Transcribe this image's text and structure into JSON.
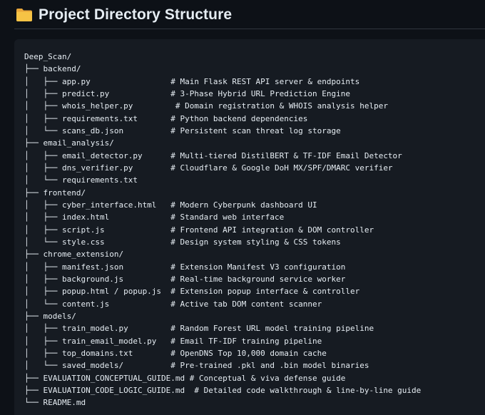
{
  "header": {
    "title": "Project Directory Structure",
    "icon": "folder-icon",
    "icon_color": "#f0b43a"
  },
  "tree_lines": [
    "Deep_Scan/",
    "├── backend/",
    "│   ├── app.py                 # Main Flask REST API server & endpoints",
    "│   ├── predict.py             # 3-Phase Hybrid URL Prediction Engine",
    "│   ├── whois_helper.py         # Domain registration & WHOIS analysis helper",
    "│   ├── requirements.txt       # Python backend dependencies",
    "│   └── scans_db.json          # Persistent scan threat log storage",
    "├── email_analysis/",
    "│   ├── email_detector.py      # Multi-tiered DistilBERT & TF-IDF Email Detector",
    "│   ├── dns_verifier.py        # Cloudflare & Google DoH MX/SPF/DMARC verifier",
    "│   └── requirements.txt",
    "├── frontend/",
    "│   ├── cyber_interface.html   # Modern Cyberpunk dashboard UI",
    "│   ├── index.html             # Standard web interface",
    "│   ├── script.js              # Frontend API integration & DOM controller",
    "│   └── style.css              # Design system styling & CSS tokens",
    "├── chrome_extension/",
    "│   ├── manifest.json          # Extension Manifest V3 configuration",
    "│   ├── background.js          # Real-time background service worker",
    "│   ├── popup.html / popup.js  # Extension popup interface & controller",
    "│   └── content.js             # Active tab DOM content scanner",
    "├── models/",
    "│   ├── train_model.py         # Random Forest URL model training pipeline",
    "│   ├── train_email_model.py   # Email TF-IDF training pipeline",
    "│   ├── top_domains.txt        # OpenDNS Top 10,000 domain cache",
    "│   └── saved_models/          # Pre-trained .pkl and .bin model binaries",
    "├── EVALUATION_CONCEPTUAL_GUIDE.md # Conceptual & viva defense guide",
    "├── EVALUATION_CODE_LOGIC_GUIDE.md  # Detailed code walkthrough & line-by-line guide",
    "└── README.md"
  ]
}
